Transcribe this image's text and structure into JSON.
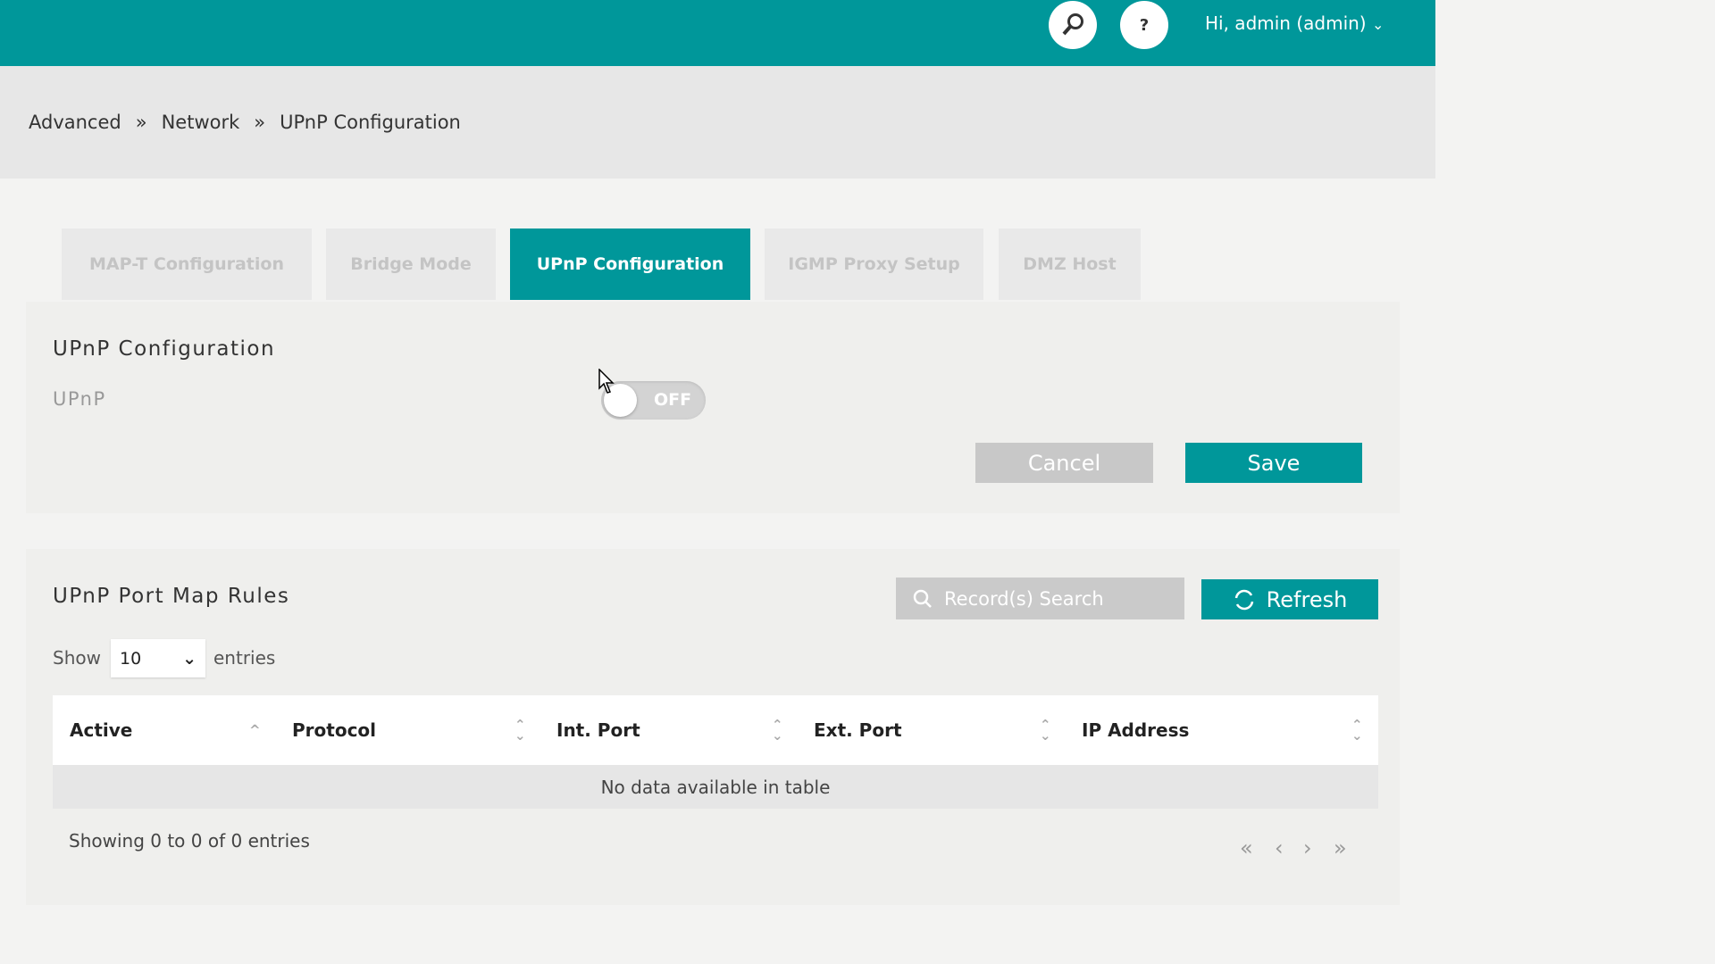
{
  "header": {
    "user_label": "Hi, admin (admin)",
    "help_label": "?",
    "accent": "#00979a"
  },
  "breadcrumb": [
    "Advanced",
    "Network",
    "UPnP Configuration"
  ],
  "tabs": [
    {
      "label": "MAP-T Configuration"
    },
    {
      "label": "Bridge Mode"
    },
    {
      "label": "UPnP Configuration",
      "active": true
    },
    {
      "label": "IGMP Proxy Setup"
    },
    {
      "label": "DMZ Host"
    }
  ],
  "config": {
    "title": "UPnP Configuration",
    "upnp_label": "UPnP",
    "toggle_state": "OFF",
    "cancel": "Cancel",
    "save": "Save"
  },
  "rules": {
    "title": "UPnP Port Map Rules",
    "search_placeholder": "Record(s) Search",
    "refresh": "Refresh",
    "show": "Show",
    "entries_value": "10",
    "entries": "entries",
    "columns": [
      "Active",
      "Protocol",
      "Int. Port",
      "Ext. Port",
      "IP Address"
    ],
    "empty": "No data available in table",
    "info": "Showing 0 to 0 of 0 entries",
    "pagination": [
      "«",
      "‹",
      "›",
      "»"
    ]
  }
}
